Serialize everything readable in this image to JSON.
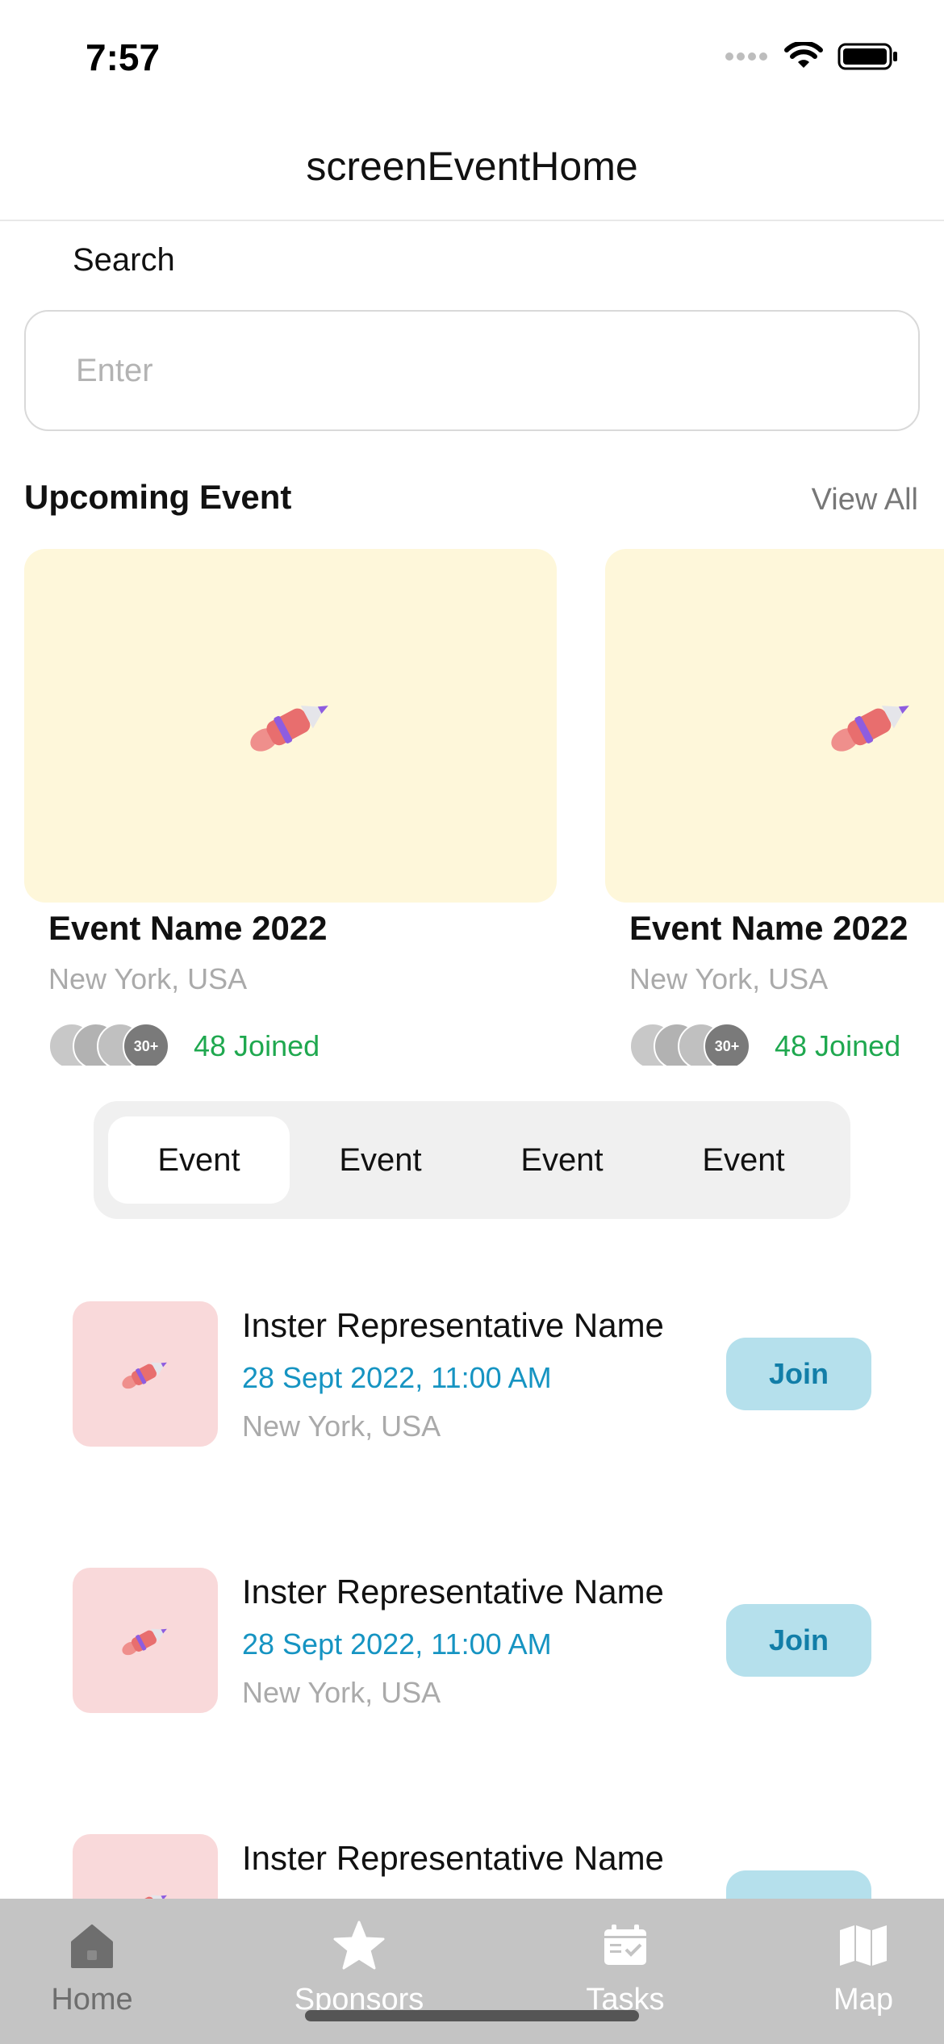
{
  "status_bar": {
    "time": "7:57"
  },
  "nav": {
    "title": "screenEventHome"
  },
  "search": {
    "label": "Search",
    "placeholder": "Enter"
  },
  "upcoming": {
    "title": "Upcoming Event",
    "view_all": "View All",
    "cards": [
      {
        "name": "Event Name 2022",
        "location": "New York, USA",
        "avatar_count": "30+",
        "joined": "48 Joined"
      },
      {
        "name": "Event Name 2022",
        "location": "New York, USA",
        "avatar_count": "30+",
        "joined": "48 Joined"
      }
    ]
  },
  "segments": {
    "items": [
      "Event",
      "Event",
      "Event",
      "Event"
    ],
    "selected": "Event"
  },
  "events": [
    {
      "title": "Inster Representative Name",
      "date": "28 Sept 2022, 11:00 AM",
      "location": "New York, USA",
      "button": "Join"
    },
    {
      "title": "Inster Representative Name",
      "date": "28 Sept 2022, 11:00 AM",
      "location": "New York, USA",
      "button": "Join"
    },
    {
      "title": "Inster Representative Name",
      "date": "",
      "location": "",
      "button": ""
    }
  ],
  "tab_bar": {
    "tabs": [
      {
        "label": "Home",
        "icon": "home-icon",
        "active": true
      },
      {
        "label": "Sponsors",
        "icon": "star-icon",
        "active": false
      },
      {
        "label": "Tasks",
        "icon": "calendar-check-icon",
        "active": false
      },
      {
        "label": "Map",
        "icon": "map-icon",
        "active": false
      }
    ]
  },
  "colors": {
    "card_background": "#fef7da",
    "thumb_background": "#f9d9da",
    "join_button": "#b5e0ec",
    "join_text": "#127ea8",
    "date_text": "#1694c2",
    "joined_text": "#1fa84f",
    "tab_bar": "#c4c4c4"
  }
}
